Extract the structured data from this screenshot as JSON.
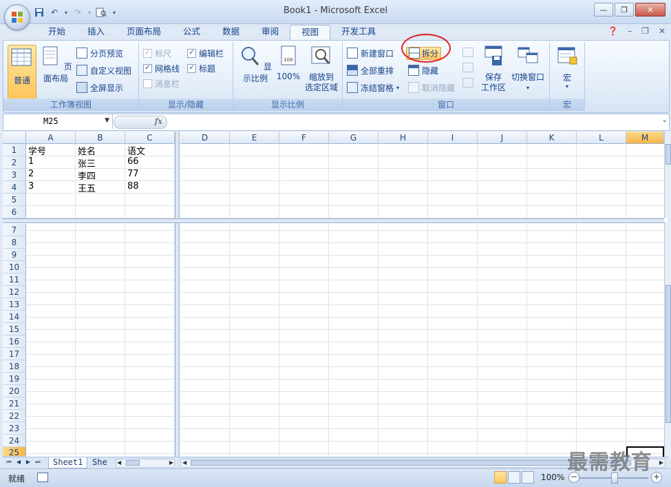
{
  "window": {
    "title": "Book1 - Microsoft Excel"
  },
  "tabs": [
    "开始",
    "插入",
    "页面布局",
    "公式",
    "数据",
    "审阅",
    "视图",
    "开发工具"
  ],
  "active_tab": "视图",
  "ribbon": {
    "workbook_views": {
      "group_label": "工作簿视图",
      "normal": "普通",
      "page_layout": "页面布局",
      "page_break_preview": "分页预览",
      "custom_views": "自定义视图",
      "full_screen": "全屏显示"
    },
    "show_hide": {
      "group_label": "显示/隐藏",
      "ruler": "标尺",
      "gridlines": "网格线",
      "message_bar": "消息栏",
      "formula_bar": "编辑栏",
      "headings": "标题"
    },
    "zoom": {
      "group_label": "显示比例",
      "zoom": "显示比例",
      "hundred": "100%",
      "zoom_to_selection_line1": "缩放到",
      "zoom_to_selection_line2": "选定区域"
    },
    "window": {
      "group_label": "窗口",
      "new_window": "新建窗口",
      "arrange_all": "全部重排",
      "freeze_panes": "冻结窗格",
      "split": "拆分",
      "hide": "隐藏",
      "unhide": "取消隐藏",
      "save_workspace_line1": "保存",
      "save_workspace_line2": "工作区",
      "switch_windows": "切换窗口"
    },
    "macros": {
      "group_label": "宏",
      "macros": "宏"
    }
  },
  "formula_bar": {
    "name_box": "M25",
    "fx": "fx",
    "content": ""
  },
  "grid": {
    "columns_left": [
      "A",
      "B",
      "C"
    ],
    "columns_right": [
      "D",
      "E",
      "F",
      "G",
      "H",
      "I",
      "J",
      "K",
      "L",
      "M"
    ],
    "selected_column": "M",
    "rows_top": [
      "1",
      "2",
      "3",
      "4",
      "5",
      "6"
    ],
    "rows_bottom": [
      "7",
      "8",
      "9",
      "10",
      "11",
      "12",
      "13",
      "14",
      "15",
      "16",
      "17",
      "18",
      "19",
      "20",
      "21",
      "22",
      "23",
      "24",
      "25"
    ],
    "cells": [
      [
        "学号",
        "姓名",
        "语文"
      ],
      [
        "1",
        "张三",
        "66"
      ],
      [
        "2",
        "李四",
        "77"
      ],
      [
        "3",
        "王五",
        "88"
      ]
    ]
  },
  "sheet_tabs": [
    "Sheet1",
    "She"
  ],
  "status": {
    "text": "就绪",
    "zoom": "100%"
  },
  "watermark": "最需教育",
  "colors": {
    "accent": "#15428b",
    "ribbon_bg": "#dfe8f5",
    "selected": "#f6b54a",
    "annotation": "#e02020"
  }
}
